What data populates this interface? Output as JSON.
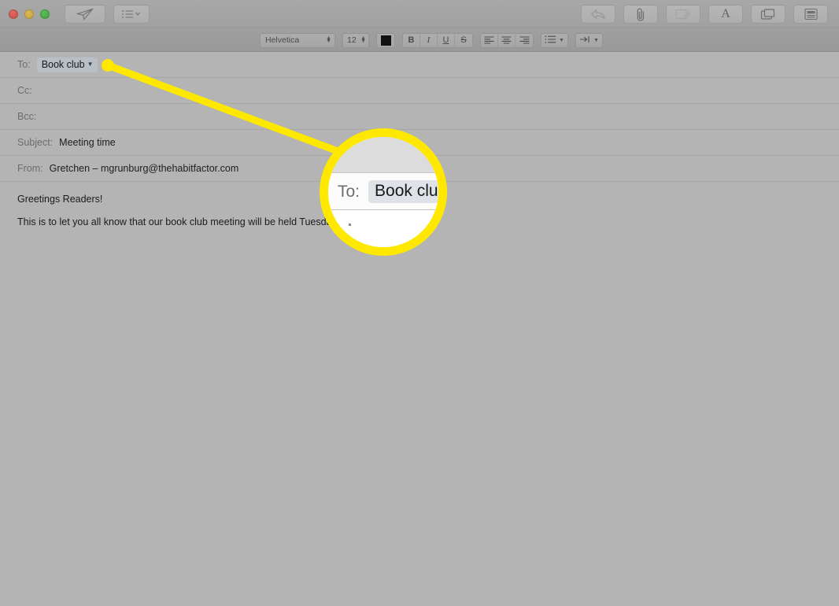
{
  "window": {
    "traffic_lights": [
      "close",
      "minimize",
      "zoom"
    ],
    "toolbar_left": [
      {
        "name": "send-button",
        "icon": "paper-plane-icon",
        "label": "Send"
      },
      {
        "name": "header-fields-button",
        "icon": "list-chevron-icon",
        "label": "Header Fields"
      }
    ],
    "toolbar_right": [
      {
        "name": "reply-button",
        "icon": "reply-arrow-icon",
        "label": "Reply",
        "disabled": true
      },
      {
        "name": "attach-button",
        "icon": "paperclip-icon",
        "label": "Attach"
      },
      {
        "name": "markup-button",
        "icon": "markup-icon",
        "label": "Markup",
        "disabled": true
      },
      {
        "name": "format-button",
        "icon": "letter-a-icon",
        "label": "A"
      },
      {
        "name": "photo-browser-button",
        "icon": "photo-browser-icon",
        "label": "Photo Browser"
      },
      {
        "name": "stationery-button",
        "icon": "stationery-icon",
        "label": "Stationery"
      }
    ]
  },
  "format_bar": {
    "font_family": "Helvetica",
    "font_size": "12",
    "text_color": "#111111",
    "style_buttons": [
      {
        "name": "bold-button",
        "label": "B"
      },
      {
        "name": "italic-button",
        "label": "I"
      },
      {
        "name": "underline-button",
        "label": "U"
      },
      {
        "name": "strikethrough-button",
        "label": "S"
      }
    ],
    "align_buttons": [
      {
        "name": "align-left-button",
        "label": "Align Left"
      },
      {
        "name": "align-center-button",
        "label": "Align Center"
      },
      {
        "name": "align-right-button",
        "label": "Align Right"
      }
    ],
    "list_button_label": "Lists",
    "indent_button_label": "Indent"
  },
  "compose": {
    "fields": [
      {
        "name": "to-field",
        "label": "To:",
        "value": "Book club",
        "is_token": true,
        "has_caret": true
      },
      {
        "name": "cc-field",
        "label": "Cc:",
        "value": "",
        "is_token": false,
        "has_caret": false
      },
      {
        "name": "bcc-field",
        "label": "Bcc:",
        "value": "",
        "is_token": false,
        "has_caret": false
      },
      {
        "name": "subject-field",
        "label": "Subject:",
        "value": "Meeting time",
        "is_token": false,
        "has_caret": false
      },
      {
        "name": "from-field",
        "label": "From:",
        "value": "Gretchen – mgrunburg@thehabitfactor.com",
        "is_token": false,
        "has_caret": false
      }
    ],
    "body_lines": [
      "Greetings Readers!",
      "This is to let you all know that our book club meeting will be held Tuesday"
    ]
  },
  "callout": {
    "highlight_color": "#ffe800",
    "magnified_label": "To:",
    "magnified_value": "Book club",
    "caret_glyph": "ˇ"
  }
}
